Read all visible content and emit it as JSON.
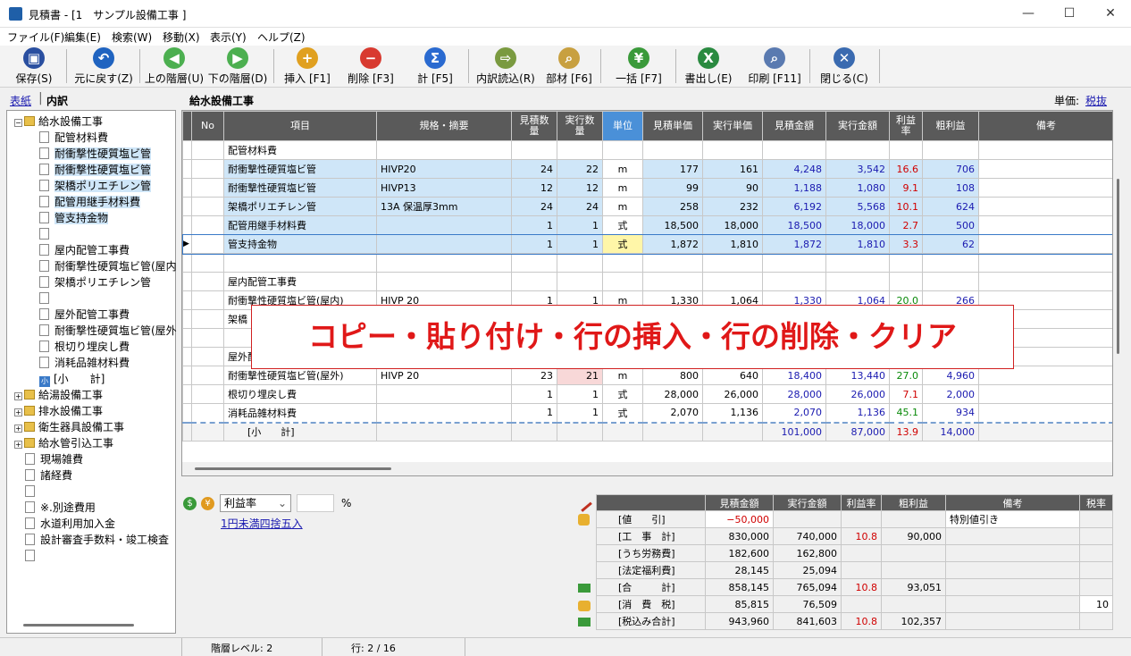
{
  "window": {
    "title": "見積書 - [1　サンプル設備工事 ]"
  },
  "menu": [
    "ファイル(F)",
    "編集(E)",
    "検索(W)",
    "移動(X)",
    "表示(Y)",
    "ヘルプ(Z)"
  ],
  "toolbar": [
    {
      "label": "保存(S)",
      "icon": "save-icon",
      "color": "#2a4fa0"
    },
    {
      "label": "元に戻す(Z)",
      "icon": "undo-icon",
      "color": "#1f63c0"
    },
    {
      "label": "上の階層(U)",
      "icon": "arrow-left-icon",
      "color": "#4caf50"
    },
    {
      "label": "下の階層(D)",
      "icon": "arrow-right-icon",
      "color": "#4caf50"
    },
    {
      "label": "挿入 [F1]",
      "icon": "plus-icon",
      "color": "#e0a020"
    },
    {
      "label": "削除 [F3]",
      "icon": "minus-icon",
      "color": "#d83a30"
    },
    {
      "label": "計 [F5]",
      "icon": "sigma-icon",
      "color": "#2a6ad0"
    },
    {
      "label": "内訳読込(R)",
      "icon": "import-icon",
      "color": "#7a9a40"
    },
    {
      "label": "部材 [F6]",
      "icon": "search-doc-icon",
      "color": "#c8a040"
    },
    {
      "label": "一括 [F7]",
      "icon": "coins-icon",
      "color": "#3a9a3a"
    },
    {
      "label": "書出し(E)",
      "icon": "excel-icon",
      "color": "#2a8a40"
    },
    {
      "label": "印刷 [F11]",
      "icon": "print-preview-icon",
      "color": "#5a7ab0"
    },
    {
      "label": "閉じる(C)",
      "icon": "close-icon",
      "color": "#3a6ab0"
    }
  ],
  "tabs": {
    "cover": "表紙",
    "detail": "内訳"
  },
  "tree": [
    {
      "label": "給水設備工事",
      "type": "folder",
      "pm": "−",
      "level": 0
    },
    {
      "label": "配管材料費",
      "type": "doc",
      "level": 1
    },
    {
      "label": "耐衝撃性硬質塩ビ管",
      "type": "doc",
      "level": 1,
      "hl": true
    },
    {
      "label": "耐衝撃性硬質塩ビ管",
      "type": "doc",
      "level": 1,
      "hl": true
    },
    {
      "label": "架橋ポリエチレン管",
      "type": "doc",
      "level": 1,
      "hl": true
    },
    {
      "label": "配管用継手材料費",
      "type": "doc",
      "level": 1,
      "hl": true
    },
    {
      "label": "管支持金物",
      "type": "doc",
      "level": 1,
      "hl": true
    },
    {
      "label": "",
      "type": "doc",
      "level": 1
    },
    {
      "label": "屋内配管工事費",
      "type": "doc",
      "level": 1
    },
    {
      "label": "耐衝撃性硬質塩ビ管(屋内",
      "type": "doc",
      "level": 1
    },
    {
      "label": "架橋ポリエチレン管",
      "type": "doc",
      "level": 1
    },
    {
      "label": "",
      "type": "doc",
      "level": 1
    },
    {
      "label": "屋外配管工事費",
      "type": "doc",
      "level": 1
    },
    {
      "label": "耐衝撃性硬質塩ビ管(屋外",
      "type": "doc",
      "level": 1
    },
    {
      "label": "根切り埋戻し費",
      "type": "doc",
      "level": 1
    },
    {
      "label": "消耗品雑材料費",
      "type": "doc",
      "level": 1
    },
    {
      "label": "[小　　計]",
      "type": "sub",
      "level": 1
    },
    {
      "label": "給湯設備工事",
      "type": "folder",
      "pm": "+",
      "level": 0
    },
    {
      "label": "排水設備工事",
      "type": "folder",
      "pm": "+",
      "level": 0
    },
    {
      "label": "衛生器具設備工事",
      "type": "folder",
      "pm": "+",
      "level": 0
    },
    {
      "label": "給水管引込工事",
      "type": "folder",
      "pm": "+",
      "level": 0
    },
    {
      "label": "現場雑費",
      "type": "doc",
      "level": 0
    },
    {
      "label": "諸経費",
      "type": "doc",
      "level": 0
    },
    {
      "label": "",
      "type": "doc",
      "level": 0
    },
    {
      "label": "※.別途費用",
      "type": "doc",
      "level": 0
    },
    {
      "label": "水道利用加入金",
      "type": "doc",
      "level": 0
    },
    {
      "label": "設計審査手数料・竣工検査",
      "type": "doc",
      "level": 0
    },
    {
      "label": "",
      "type": "doc",
      "level": 0
    }
  ],
  "grid": {
    "title": "給水設備工事",
    "unit_label": "単価:",
    "unit_link": "税抜",
    "headers": [
      "No",
      "項目",
      "規格・摘要",
      "見積数量",
      "実行数量",
      "単位",
      "見積単価",
      "実行単価",
      "見積金額",
      "実行金額",
      "利益率",
      "粗利益",
      "備考"
    ],
    "rows": [
      {
        "item": "配管材料費",
        "spec": "",
        "q1": "",
        "q2": "",
        "unit": "",
        "p1": "",
        "p2": "",
        "a1": "",
        "a2": "",
        "rate": "",
        "profit": "",
        "sel": false
      },
      {
        "item": "耐衝撃性硬質塩ビ管",
        "spec": "HIVP20",
        "q1": "24",
        "q2": "22",
        "unit": "m",
        "p1": "177",
        "p2": "161",
        "a1": "4,248",
        "a2": "3,542",
        "rate": "16.6",
        "profit": "706",
        "sel": true
      },
      {
        "item": "耐衝撃性硬質塩ビ管",
        "spec": "HIVP13",
        "q1": "12",
        "q2": "12",
        "unit": "m",
        "p1": "99",
        "p2": "90",
        "a1": "1,188",
        "a2": "1,080",
        "rate": "9.1",
        "profit": "108",
        "sel": true
      },
      {
        "item": "架橋ポリエチレン管",
        "spec": "13A 保温厚3mm",
        "q1": "24",
        "q2": "24",
        "unit": "m",
        "p1": "258",
        "p2": "232",
        "a1": "6,192",
        "a2": "5,568",
        "rate": "10.1",
        "profit": "624",
        "sel": true
      },
      {
        "item": "配管用継手材料費",
        "spec": "",
        "q1": "1",
        "q2": "1",
        "unit": "式",
        "p1": "18,500",
        "p2": "18,000",
        "a1": "18,500",
        "a2": "18,000",
        "rate": "2.7",
        "profit": "500",
        "sel": true
      },
      {
        "item": "管支持金物",
        "spec": "",
        "q1": "1",
        "q2": "1",
        "unit": "式",
        "p1": "1,872",
        "p2": "1,810",
        "a1": "1,872",
        "a2": "1,810",
        "rate": "3.3",
        "profit": "62",
        "sel": true,
        "cur": true
      },
      {
        "item": "",
        "spec": "",
        "q1": "",
        "q2": "",
        "unit": "",
        "p1": "",
        "p2": "",
        "a1": "",
        "a2": "",
        "rate": "",
        "profit": ""
      },
      {
        "item": "屋内配管工事費",
        "spec": "",
        "q1": "",
        "q2": "",
        "unit": "",
        "p1": "",
        "p2": "",
        "a1": "",
        "a2": "",
        "rate": "",
        "profit": ""
      },
      {
        "item": "耐衝撃性硬質塩ビ管(屋内)",
        "spec": "HIVP 20",
        "q1": "1",
        "q2": "1",
        "unit": "m",
        "p1": "1,330",
        "p2": "1,064",
        "a1": "1,330",
        "a2": "1,064",
        "rate": "20.0",
        "profit": "266",
        "rc": "green"
      },
      {
        "item": "架橋",
        "spec": "",
        "q1": "",
        "q2": "",
        "unit": "",
        "p1": "",
        "p2": "",
        "a1": "",
        "a2": "",
        "rate": "",
        "profit": ""
      },
      {
        "item": "",
        "spec": "",
        "q1": "",
        "q2": "",
        "unit": "",
        "p1": "",
        "p2": "",
        "a1": "",
        "a2": "",
        "rate": "",
        "profit": ""
      },
      {
        "item": "屋外配",
        "spec": "",
        "q1": "",
        "q2": "",
        "unit": "",
        "p1": "",
        "p2": "",
        "a1": "",
        "a2": "",
        "rate": "",
        "profit": ""
      },
      {
        "item": "耐衝撃性硬質塩ビ管(屋外)",
        "spec": "HIVP 20",
        "q1": "23",
        "q2": "21",
        "unit": "m",
        "p1": "800",
        "p2": "640",
        "a1": "18,400",
        "a2": "13,440",
        "rate": "27.0",
        "profit": "4,960",
        "rc": "green",
        "pinkq2": true
      },
      {
        "item": "根切り埋戻し費",
        "spec": "",
        "q1": "1",
        "q2": "1",
        "unit": "式",
        "p1": "28,000",
        "p2": "26,000",
        "a1": "28,000",
        "a2": "26,000",
        "rate": "7.1",
        "profit": "2,000"
      },
      {
        "item": "消耗品雑材料費",
        "spec": "",
        "q1": "1",
        "q2": "1",
        "unit": "式",
        "p1": "2,070",
        "p2": "1,136",
        "a1": "2,070",
        "a2": "1,136",
        "rate": "45.1",
        "profit": "934",
        "rc": "green"
      },
      {
        "item": "　　[小　　計]",
        "spec": "",
        "q1": "",
        "q2": "",
        "unit": "",
        "p1": "",
        "p2": "",
        "a1": "101,000",
        "a2": "87,000",
        "rate": "13.9",
        "profit": "14,000",
        "sub": true
      }
    ]
  },
  "overlay": "コピー・貼り付け・行の挿入・行の削除・クリア",
  "bottom": {
    "select": "利益率",
    "unit": "%",
    "link": "1円未満四捨五入"
  },
  "summary": {
    "headers": [
      "",
      "見積金額",
      "実行金額",
      "利益率",
      "粗利益",
      "備考",
      "税率"
    ],
    "rows": [
      {
        "label": "[値　　引]",
        "a1": "−50,000",
        "a2": "",
        "rate": "",
        "profit": "",
        "note": "特別値引き",
        "tax": "",
        "red1": true
      },
      {
        "label": "[工　事　計]",
        "a1": "830,000",
        "a2": "740,000",
        "rate": "10.8",
        "profit": "90,000",
        "note": "",
        "tax": ""
      },
      {
        "label": "[うち労務費]",
        "a1": "182,600",
        "a2": "162,800",
        "rate": "",
        "profit": "",
        "note": "",
        "tax": ""
      },
      {
        "label": "[法定福利費]",
        "a1": "28,145",
        "a2": "25,094",
        "rate": "",
        "profit": "",
        "note": "",
        "tax": ""
      },
      {
        "label": "[合　　　計]",
        "a1": "858,145",
        "a2": "765,094",
        "rate": "10.8",
        "profit": "93,051",
        "note": "",
        "tax": ""
      },
      {
        "label": "[消　費　税]",
        "a1": "85,815",
        "a2": "76,509",
        "rate": "",
        "profit": "",
        "note": "",
        "tax": "10"
      },
      {
        "label": "[税込み合計]",
        "a1": "943,960",
        "a2": "841,603",
        "rate": "10.8",
        "profit": "102,357",
        "note": "",
        "tax": ""
      }
    ]
  },
  "status": {
    "level": "階層レベル: 2",
    "row": "行: 2 / 16"
  }
}
